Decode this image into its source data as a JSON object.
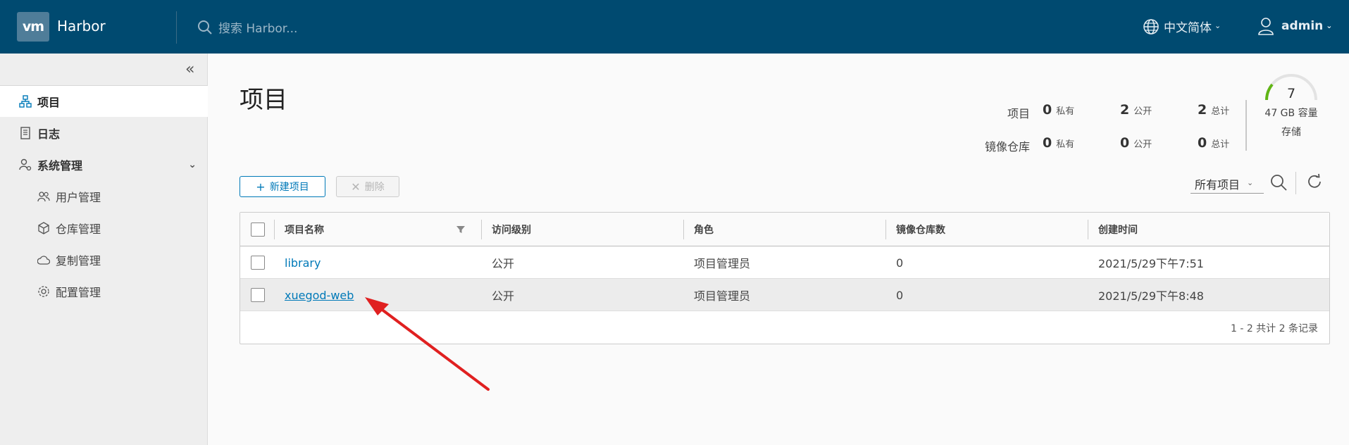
{
  "header": {
    "logo_text": "vm",
    "app_name": "Harbor",
    "search_placeholder": "搜索 Harbor...",
    "language": "中文简体",
    "user": "admin"
  },
  "sidebar": {
    "items": [
      {
        "label": "项目",
        "icon": "projects-icon",
        "active": true
      },
      {
        "label": "日志",
        "icon": "log-icon"
      },
      {
        "label": "系统管理",
        "icon": "user-gear-icon"
      }
    ],
    "sub_items": [
      {
        "label": "用户管理",
        "icon": "users-icon"
      },
      {
        "label": "仓库管理",
        "icon": "box-icon"
      },
      {
        "label": "复制管理",
        "icon": "cloud-icon"
      },
      {
        "label": "配置管理",
        "icon": "gear-icon"
      }
    ]
  },
  "main": {
    "title": "项目",
    "stats": {
      "projects_label": "项目",
      "repos_label": "镜像仓库",
      "projects": {
        "private": "0",
        "public": "2",
        "total": "2"
      },
      "repos": {
        "private": "0",
        "public": "0",
        "total": "0"
      },
      "private_label": "私有",
      "public_label": "公开",
      "total_label": "总计"
    },
    "storage": {
      "value": "7",
      "capacity": "47 GB 容量",
      "label": "存储",
      "used_fraction": 0.15
    },
    "buttons": {
      "new_project": "新建项目",
      "delete": "删除"
    },
    "filter": "所有项目",
    "table": {
      "columns": [
        "项目名称",
        "访问级别",
        "角色",
        "镜像仓库数",
        "创建时间"
      ],
      "rows": [
        {
          "name": "library",
          "access": "公开",
          "role": "项目管理员",
          "repos": "0",
          "created": "2021/5/29下午7:51"
        },
        {
          "name": "xuegod-web",
          "access": "公开",
          "role": "项目管理员",
          "repos": "0",
          "created": "2021/5/29下午8:48"
        }
      ],
      "footer": "1 - 2 共计 2 条记录"
    }
  },
  "colors": {
    "header_bg": "#004a70",
    "accent": "#0079b8",
    "annotation_arrow": "#e02020"
  }
}
